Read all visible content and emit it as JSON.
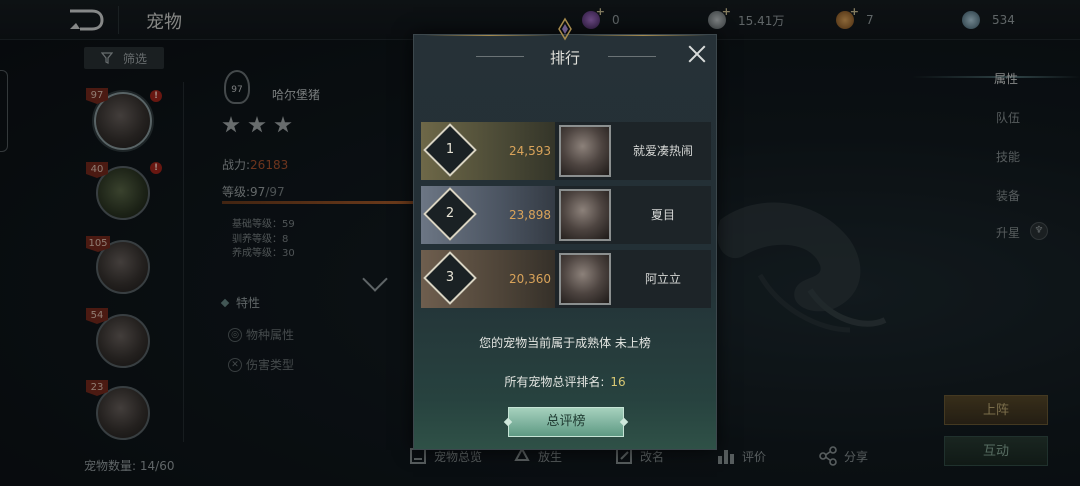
{
  "header": {
    "title": "宠物"
  },
  "currencies": [
    {
      "icon": "gem-icon",
      "value": "0"
    },
    {
      "icon": "silver-coin-icon",
      "value": "15.41万"
    },
    {
      "icon": "gold-coin-icon",
      "value": "7"
    },
    {
      "icon": "crystal-icon",
      "value": "534"
    }
  ],
  "sidebar": {
    "filter_label": "筛选",
    "pets": [
      {
        "level": "97",
        "alert": "!"
      },
      {
        "level": "40",
        "alert": "!"
      },
      {
        "level": "105"
      },
      {
        "level": "54"
      },
      {
        "level": "23"
      }
    ],
    "count_label": "宠物数量:",
    "count_value": "14/60"
  },
  "detail": {
    "badge_level": "97",
    "name": "哈尔堡猪",
    "stars": 3,
    "power_label": "战力:",
    "power_value": "26183",
    "level_label": "等级:",
    "level_current": "97",
    "level_max": "/97",
    "level_fraction": 1.0,
    "sub_stats": [
      {
        "label": "基础等级：59"
      },
      {
        "label": "驯养等级：8"
      },
      {
        "label": "养成等级：30"
      }
    ],
    "traits_title": "特性",
    "traits": [
      "物种属性",
      "伤害类型"
    ]
  },
  "right_tabs": {
    "items": [
      "属性",
      "队伍",
      "技能",
      "装备",
      "升星"
    ],
    "active": "属性"
  },
  "actions": {
    "deploy": "上阵",
    "interact": "互动"
  },
  "bottom": [
    "宠物总览",
    "放生",
    "改名",
    "评价",
    "分享"
  ],
  "modal": {
    "title": "排行",
    "ranks": [
      {
        "rank": "1",
        "score": "24,593",
        "name": "就爱凑热闹"
      },
      {
        "rank": "2",
        "score": "23,898",
        "name": "夏目"
      },
      {
        "rank": "3",
        "score": "20,360",
        "name": "阿立立"
      }
    ],
    "status_text": "您的宠物当前属于成熟体 未上榜",
    "overall_label": "所有宠物总评排名:",
    "overall_value": "16",
    "button_label": "总评榜"
  },
  "colors": {
    "accent_gold": "#d9a35a",
    "power_red": "#b0552f",
    "rank_number": "#d8c873",
    "button_teal": "#5e9a84"
  }
}
